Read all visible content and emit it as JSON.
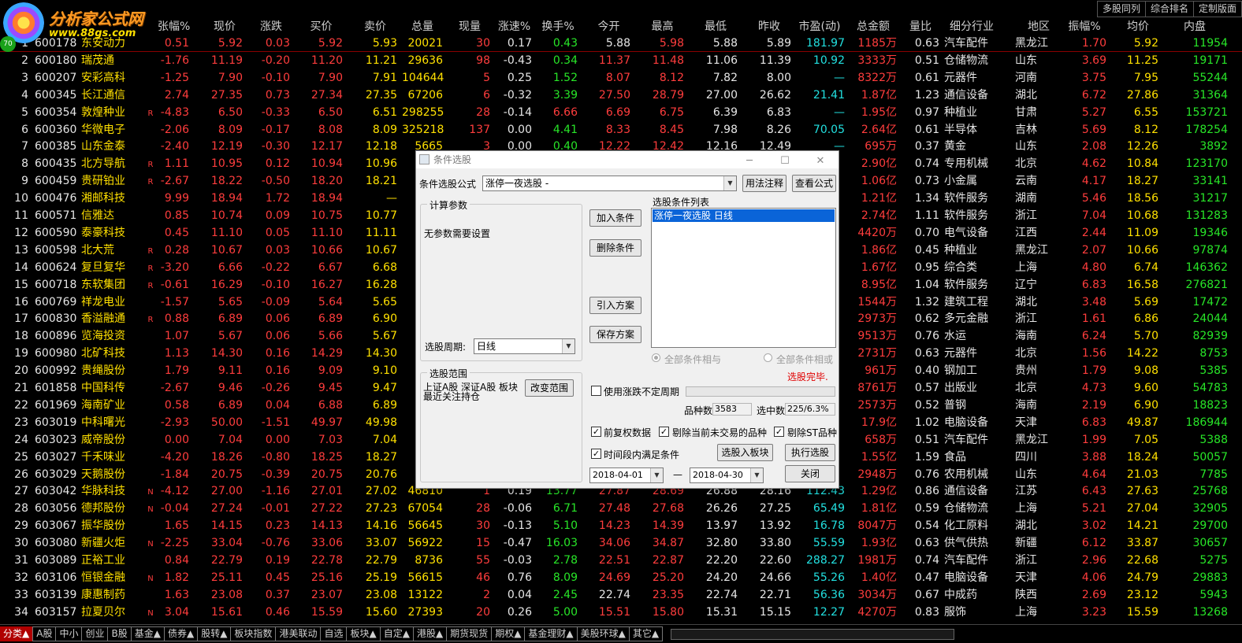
{
  "app": {
    "name": "分析家公式网",
    "url": "www.88gs.com",
    "badge": "70"
  },
  "top_buttons": [
    "多股同列",
    "综合排名",
    "定制版面"
  ],
  "columns": [
    "",
    "",
    "",
    "张幅%",
    "现价",
    "涨跌",
    "买价",
    "卖价",
    "总量",
    "现量",
    "涨速%",
    "换手%",
    "今开",
    "最高",
    "最低",
    "昨收",
    "市盈(动)",
    "总金额",
    "量比",
    "细分行业",
    "地区",
    "振幅%",
    "均价",
    "内盘"
  ],
  "rows": [
    [
      "1",
      "600178",
      "东安动力",
      "",
      "0.51",
      "5.92",
      "0.03",
      "5.92",
      "5.93",
      "20021",
      "30",
      "0.17",
      "0.43",
      "5.88",
      "5.98",
      "5.88",
      "5.89",
      "181.97",
      "1185万",
      "0.63",
      "汽车配件",
      "黑龙江",
      "1.70",
      "5.92",
      "11954"
    ],
    [
      "2",
      "600180",
      "瑞茂通",
      "",
      "-1.76",
      "11.19",
      "-0.20",
      "11.20",
      "11.21",
      "29636",
      "98",
      "-0.43",
      "0.34",
      "11.37",
      "11.48",
      "11.06",
      "11.39",
      "10.92",
      "3333万",
      "0.51",
      "仓储物流",
      "山东",
      "3.69",
      "11.25",
      "19171"
    ],
    [
      "3",
      "600207",
      "安彩高科",
      "",
      "-1.25",
      "7.90",
      "-0.10",
      "7.90",
      "7.91",
      "104644",
      "5",
      "0.25",
      "1.52",
      "8.07",
      "8.12",
      "7.82",
      "8.00",
      "—",
      "8322万",
      "0.61",
      "元器件",
      "河南",
      "3.75",
      "7.95",
      "55244"
    ],
    [
      "4",
      "600345",
      "长江通信",
      "",
      "2.74",
      "27.35",
      "0.73",
      "27.34",
      "27.35",
      "67206",
      "6",
      "-0.32",
      "3.39",
      "27.50",
      "28.79",
      "27.00",
      "26.62",
      "21.41",
      "1.87亿",
      "1.23",
      "通信设备",
      "湖北",
      "6.72",
      "27.86",
      "31364"
    ],
    [
      "5",
      "600354",
      "敦煌种业",
      "R",
      "-4.83",
      "6.50",
      "-0.33",
      "6.50",
      "6.51",
      "298255",
      "28",
      "-0.14",
      "6.66",
      "6.69",
      "6.75",
      "6.39",
      "6.83",
      "—",
      "1.95亿",
      "0.97",
      "种植业",
      "甘肃",
      "5.27",
      "6.55",
      "153721"
    ],
    [
      "6",
      "600360",
      "华微电子",
      "",
      "-2.06",
      "8.09",
      "-0.17",
      "8.08",
      "8.09",
      "325218",
      "137",
      "0.00",
      "4.41",
      "8.33",
      "8.45",
      "7.98",
      "8.26",
      "70.05",
      "2.64亿",
      "0.61",
      "半导体",
      "吉林",
      "5.69",
      "8.12",
      "178254"
    ],
    [
      "7",
      "600385",
      "山东金泰",
      "",
      "-2.40",
      "12.19",
      "-0.30",
      "12.17",
      "12.18",
      "5665",
      "3",
      "0.00",
      "0.40",
      "12.22",
      "12.42",
      "12.16",
      "12.49",
      "—",
      "695万",
      "0.37",
      "黄金",
      "山东",
      "2.08",
      "12.26",
      "3892"
    ],
    [
      "8",
      "600435",
      "北方导航",
      "R",
      "1.11",
      "10.95",
      "0.12",
      "10.94",
      "10.96",
      "26",
      "",
      "",
      "",
      "",
      "",
      "",
      "",
      "",
      "2.90亿",
      "0.74",
      "专用机械",
      "北京",
      "4.62",
      "10.84",
      "123170"
    ],
    [
      "9",
      "600459",
      "贵研铂业",
      "R",
      "-2.67",
      "18.22",
      "-0.50",
      "18.20",
      "18.21",
      "5",
      "",
      "",
      "",
      "",
      "",
      "",
      "",
      "",
      "1.06亿",
      "0.73",
      "小金属",
      "云南",
      "4.17",
      "18.27",
      "33141"
    ],
    [
      "10",
      "600476",
      "湘邮科技",
      "",
      "9.99",
      "18.94",
      "1.72",
      "18.94",
      "—",
      "",
      "",
      "",
      "",
      "",
      "",
      "",
      "",
      "",
      "1.21亿",
      "1.34",
      "软件服务",
      "湖南",
      "5.46",
      "18.56",
      "31217"
    ],
    [
      "11",
      "600571",
      "信雅达",
      "",
      "0.85",
      "10.74",
      "0.09",
      "10.75",
      "10.77",
      "2",
      "",
      "",
      "",
      "",
      "",
      "",
      "",
      "",
      "2.74亿",
      "1.11",
      "软件服务",
      "浙江",
      "7.04",
      "10.68",
      "131283"
    ],
    [
      "12",
      "600590",
      "泰豪科技",
      "",
      "0.45",
      "11.10",
      "0.05",
      "11.10",
      "11.11",
      "",
      "",
      "",
      "",
      "",
      "",
      "",
      "",
      "",
      "4420万",
      "0.70",
      "电气设备",
      "江西",
      "2.44",
      "11.09",
      "19346"
    ],
    [
      "13",
      "600598",
      "北大荒",
      "R",
      "0.28",
      "10.67",
      "0.03",
      "10.66",
      "10.67",
      "1",
      "",
      "",
      "",
      "",
      "",
      "",
      "",
      "",
      "1.86亿",
      "0.45",
      "种植业",
      "黑龙江",
      "2.07",
      "10.66",
      "97874"
    ],
    [
      "14",
      "600624",
      "复旦复华",
      "R",
      "-3.20",
      "6.66",
      "-0.22",
      "6.67",
      "6.68",
      "2",
      "",
      "",
      "",
      "",
      "",
      "",
      "",
      "",
      "1.67亿",
      "0.95",
      "综合类",
      "上海",
      "4.80",
      "6.74",
      "146362"
    ],
    [
      "15",
      "600718",
      "东软集团",
      "R",
      "-0.61",
      "16.29",
      "-0.10",
      "16.27",
      "16.28",
      "5",
      "",
      "",
      "",
      "",
      "",
      "",
      "",
      "",
      "8.95亿",
      "1.04",
      "软件服务",
      "辽宁",
      "6.83",
      "16.58",
      "276821"
    ],
    [
      "16",
      "600769",
      "祥龙电业",
      "",
      "-1.57",
      "5.65",
      "-0.09",
      "5.64",
      "5.65",
      "",
      "",
      "",
      "",
      "",
      "",
      "",
      "",
      "",
      "1544万",
      "1.32",
      "建筑工程",
      "湖北",
      "3.48",
      "5.69",
      "17472"
    ],
    [
      "17",
      "600830",
      "香溢融通",
      "R",
      "0.88",
      "6.89",
      "0.06",
      "6.89",
      "6.90",
      "",
      "",
      "",
      "",
      "",
      "",
      "",
      "",
      "",
      "2973万",
      "0.62",
      "多元金融",
      "浙江",
      "1.61",
      "6.86",
      "24044"
    ],
    [
      "18",
      "600896",
      "览海投资",
      "",
      "1.07",
      "5.67",
      "0.06",
      "5.66",
      "5.67",
      "1",
      "",
      "",
      "",
      "",
      "",
      "",
      "",
      "",
      "9513万",
      "0.76",
      "水运",
      "海南",
      "6.24",
      "5.70",
      "82939"
    ],
    [
      "19",
      "600980",
      "北矿科技",
      "",
      "1.13",
      "14.30",
      "0.16",
      "14.29",
      "14.30",
      "",
      "",
      "",
      "",
      "",
      "",
      "",
      "",
      "",
      "2731万",
      "0.63",
      "元器件",
      "北京",
      "1.56",
      "14.22",
      "8753"
    ],
    [
      "20",
      "600992",
      "贵绳股份",
      "",
      "1.79",
      "9.11",
      "0.16",
      "9.09",
      "9.10",
      "",
      "",
      "",
      "",
      "",
      "",
      "",
      "",
      "",
      "961万",
      "0.40",
      "钢加工",
      "贵州",
      "1.79",
      "9.08",
      "5385"
    ],
    [
      "21",
      "601858",
      "中国科传",
      "",
      "-2.67",
      "9.46",
      "-0.26",
      "9.45",
      "9.47",
      "",
      "",
      "",
      "",
      "",
      "",
      "",
      "",
      "",
      "8761万",
      "0.57",
      "出版业",
      "北京",
      "4.73",
      "9.60",
      "54783"
    ],
    [
      "22",
      "601969",
      "海南矿业",
      "",
      "0.58",
      "6.89",
      "0.04",
      "6.88",
      "6.89",
      "",
      "",
      "",
      "",
      "",
      "",
      "",
      "",
      "",
      "2573万",
      "0.52",
      "普钢",
      "海南",
      "2.19",
      "6.90",
      "18823"
    ],
    [
      "23",
      "603019",
      "中科曙光",
      "",
      "-2.93",
      "50.00",
      "-1.51",
      "49.97",
      "49.98",
      "3",
      "",
      "",
      "",
      "",
      "",
      "",
      "",
      "",
      "17.9亿",
      "1.02",
      "电脑设备",
      "天津",
      "6.83",
      "49.87",
      "186944"
    ],
    [
      "24",
      "603023",
      "威帝股份",
      "",
      "0.00",
      "7.04",
      "0.00",
      "7.03",
      "7.04",
      "",
      "",
      "",
      "",
      "",
      "",
      "",
      "",
      "",
      "658万",
      "0.51",
      "汽车配件",
      "黑龙江",
      "1.99",
      "7.05",
      "5388"
    ],
    [
      "25",
      "603027",
      "千禾味业",
      "",
      "-4.20",
      "18.26",
      "-0.80",
      "18.25",
      "18.27",
      "",
      "",
      "",
      "",
      "",
      "",
      "",
      "",
      "",
      "1.55亿",
      "1.59",
      "食品",
      "四川",
      "3.88",
      "18.24",
      "50057"
    ],
    [
      "26",
      "603029",
      "天鹅股份",
      "",
      "-1.84",
      "20.75",
      "-0.39",
      "20.75",
      "20.76",
      "",
      "",
      "",
      "",
      "",
      "",
      "",
      "",
      "",
      "2948万",
      "0.76",
      "农用机械",
      "山东",
      "4.64",
      "21.03",
      "7785"
    ],
    [
      "27",
      "603042",
      "华脉科技",
      "N",
      "-4.12",
      "27.00",
      "-1.16",
      "27.01",
      "27.02",
      "46810",
      "1",
      "0.19",
      "13.77",
      "27.87",
      "28.69",
      "26.88",
      "28.16",
      "112.43",
      "1.29亿",
      "0.86",
      "通信设备",
      "江苏",
      "6.43",
      "27.63",
      "25768"
    ],
    [
      "28",
      "603056",
      "德邦股份",
      "N",
      "-0.04",
      "27.24",
      "-0.01",
      "27.22",
      "27.23",
      "67054",
      "28",
      "-0.06",
      "6.71",
      "27.48",
      "27.68",
      "26.26",
      "27.25",
      "65.49",
      "1.81亿",
      "0.59",
      "仓储物流",
      "上海",
      "5.21",
      "27.04",
      "32905"
    ],
    [
      "29",
      "603067",
      "振华股份",
      "",
      "1.65",
      "14.15",
      "0.23",
      "14.13",
      "14.16",
      "56645",
      "30",
      "-0.13",
      "5.10",
      "14.23",
      "14.39",
      "13.97",
      "13.92",
      "16.78",
      "8047万",
      "0.54",
      "化工原料",
      "湖北",
      "3.02",
      "14.21",
      "29700"
    ],
    [
      "30",
      "603080",
      "新疆火炬",
      "N",
      "-2.25",
      "33.04",
      "-0.76",
      "33.06",
      "33.07",
      "56922",
      "15",
      "-0.47",
      "16.03",
      "34.06",
      "34.87",
      "32.80",
      "33.80",
      "55.59",
      "1.93亿",
      "0.63",
      "供气供热",
      "新疆",
      "6.12",
      "33.87",
      "30657"
    ],
    [
      "31",
      "603089",
      "正裕工业",
      "",
      "0.84",
      "22.79",
      "0.19",
      "22.78",
      "22.79",
      "8736",
      "55",
      "-0.03",
      "2.78",
      "22.51",
      "22.87",
      "22.20",
      "22.60",
      "288.27",
      "1981万",
      "0.74",
      "汽车配件",
      "浙江",
      "2.96",
      "22.68",
      "5275"
    ],
    [
      "32",
      "603106",
      "恒银金融",
      "N",
      "1.82",
      "25.11",
      "0.45",
      "25.16",
      "25.19",
      "56615",
      "46",
      "0.76",
      "8.09",
      "24.69",
      "25.20",
      "24.20",
      "24.66",
      "55.26",
      "1.40亿",
      "0.47",
      "电脑设备",
      "天津",
      "4.06",
      "24.79",
      "29883"
    ],
    [
      "33",
      "603139",
      "康惠制药",
      "",
      "1.63",
      "23.08",
      "0.37",
      "23.07",
      "23.08",
      "13122",
      "2",
      "0.04",
      "2.45",
      "22.74",
      "23.35",
      "22.74",
      "22.71",
      "56.36",
      "3034万",
      "0.67",
      "中成药",
      "陕西",
      "2.69",
      "23.12",
      "5943"
    ],
    [
      "34",
      "603157",
      "拉夏贝尔",
      "N",
      "3.04",
      "15.61",
      "0.46",
      "15.59",
      "15.60",
      "27393",
      "20",
      "0.26",
      "5.00",
      "15.51",
      "15.80",
      "15.31",
      "15.15",
      "12.27",
      "4270万",
      "0.83",
      "服饰",
      "上海",
      "3.23",
      "15.59",
      "13268"
    ]
  ],
  "bottom_tabs": [
    "分类▲",
    "A股",
    "中小",
    "创业",
    "B股",
    "基金▲",
    "债券▲",
    "股转▲",
    "板块指数",
    "港美联动",
    "自选",
    "板块▲",
    "自定▲",
    "港股▲",
    "期货现货",
    "期权▲",
    "基金理财▲",
    "美股环球▲",
    "其它▲"
  ],
  "dialog": {
    "title": "条件选股",
    "formula_label": "条件选股公式",
    "formula_value": "涨停一夜选股 -",
    "usage_button": "用法注释",
    "view_formula_button": "查看公式",
    "params_group": "计算参数",
    "params_text": "无参数需要设置",
    "period_label": "选股周期:",
    "period_value": "日线",
    "add_button": "加入条件",
    "delete_button": "删除条件",
    "import_button": "引入方案",
    "save_button": "保存方案",
    "conditions_label": "选股条件列表",
    "condition_item": "涨停一夜选股  日线",
    "radio_and": "全部条件相与",
    "radio_or": "全部条件相或",
    "status": "选股完毕.",
    "range_group": "选股范围",
    "range_text": "上证A股 深证A股 板块 最近关注持仓",
    "change_range_button": "改变范围",
    "use_uncertain_label": "使用涨跌不定周期",
    "count_label": "品种数",
    "count_value": "3583",
    "selected_label": "选中数",
    "selected_value": "225/6.3%",
    "check_prior": "前复权数据",
    "check_exclude_untraded": "剔除当前未交易的品种",
    "check_exclude_st": "剔除ST品种",
    "check_time": "时间段内满足条件",
    "to_block_button": "选股入板块",
    "execute_button": "执行选股",
    "start_date": "2018-04-01",
    "end_date": "2018-04-30",
    "date_sep": "—",
    "close_button": "关闭"
  }
}
